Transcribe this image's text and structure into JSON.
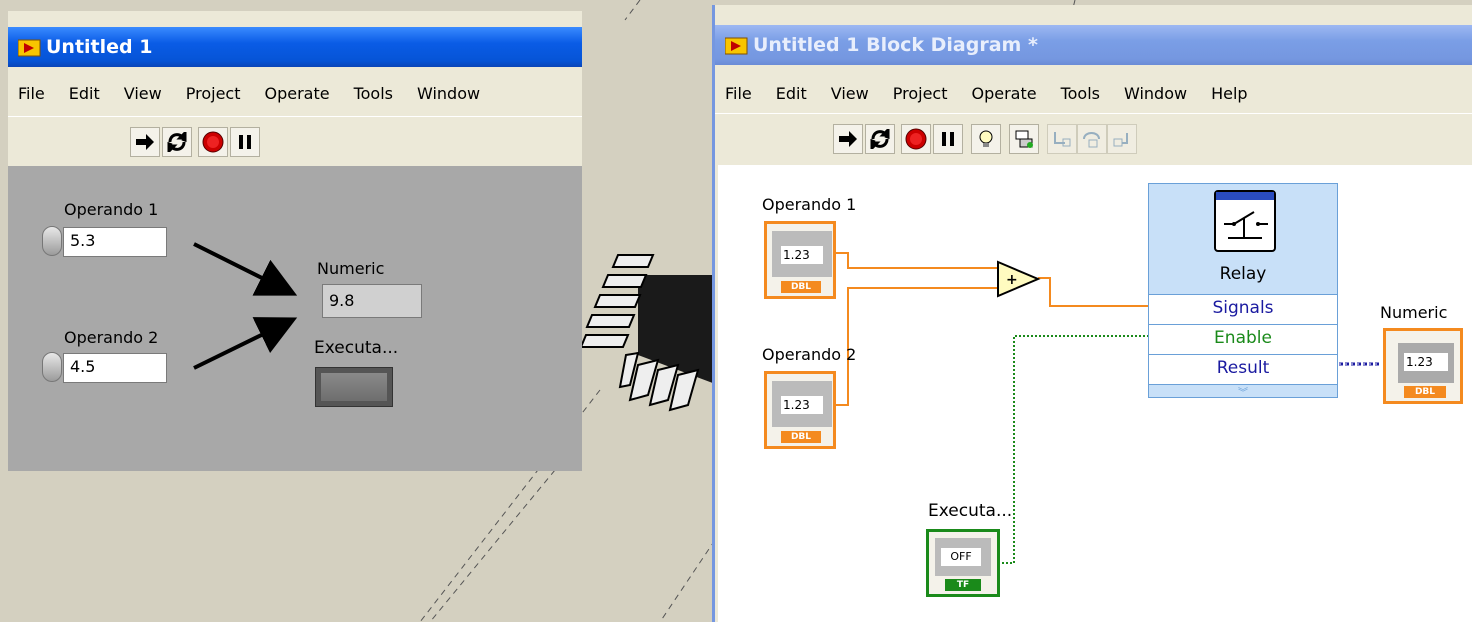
{
  "front_panel": {
    "title": "Untitled 1",
    "menu": [
      "File",
      "Edit",
      "View",
      "Project",
      "Operate",
      "Tools",
      "Window"
    ],
    "toolbar": [
      "run-arrow-icon",
      "run-continuously-icon",
      "abort-icon",
      "pause-icon"
    ],
    "controls": {
      "op1_label": "Operando 1",
      "op1_value": "5.3",
      "op2_label": "Operando 2",
      "op2_value": "4.5",
      "numeric_label": "Numeric",
      "numeric_value": "9.8",
      "execute_label": "Executa..."
    }
  },
  "block_diagram": {
    "title": "Untitled 1 Block Diagram *",
    "menu": [
      "File",
      "Edit",
      "View",
      "Project",
      "Operate",
      "Tools",
      "Window",
      "Help"
    ],
    "toolbar": [
      "run-arrow-icon",
      "run-continuously-icon",
      "abort-icon",
      "pause-icon",
      "highlight-execution-icon",
      "retain-wire-values-icon",
      "step-into-icon",
      "step-over-icon",
      "step-out-icon"
    ],
    "nodes": {
      "op1_label": "Operando 1",
      "op2_label": "Operando 2",
      "terminal_text": "1.23",
      "dbl_tag": "DBL",
      "add_symbol": "+",
      "relay_title": "Relay",
      "relay_in1": "Signals",
      "relay_in2": "Enable",
      "relay_out": "Result",
      "numeric_label": "Numeric",
      "execute_label": "Executa...",
      "off_text": "OFF",
      "tf_tag": "TF"
    }
  },
  "colors": {
    "orange_wire": "#f48a1f",
    "green_wire": "#1a8a1a",
    "blue_wire": "#1a1aa0",
    "title_active": "#0a5ce6"
  }
}
